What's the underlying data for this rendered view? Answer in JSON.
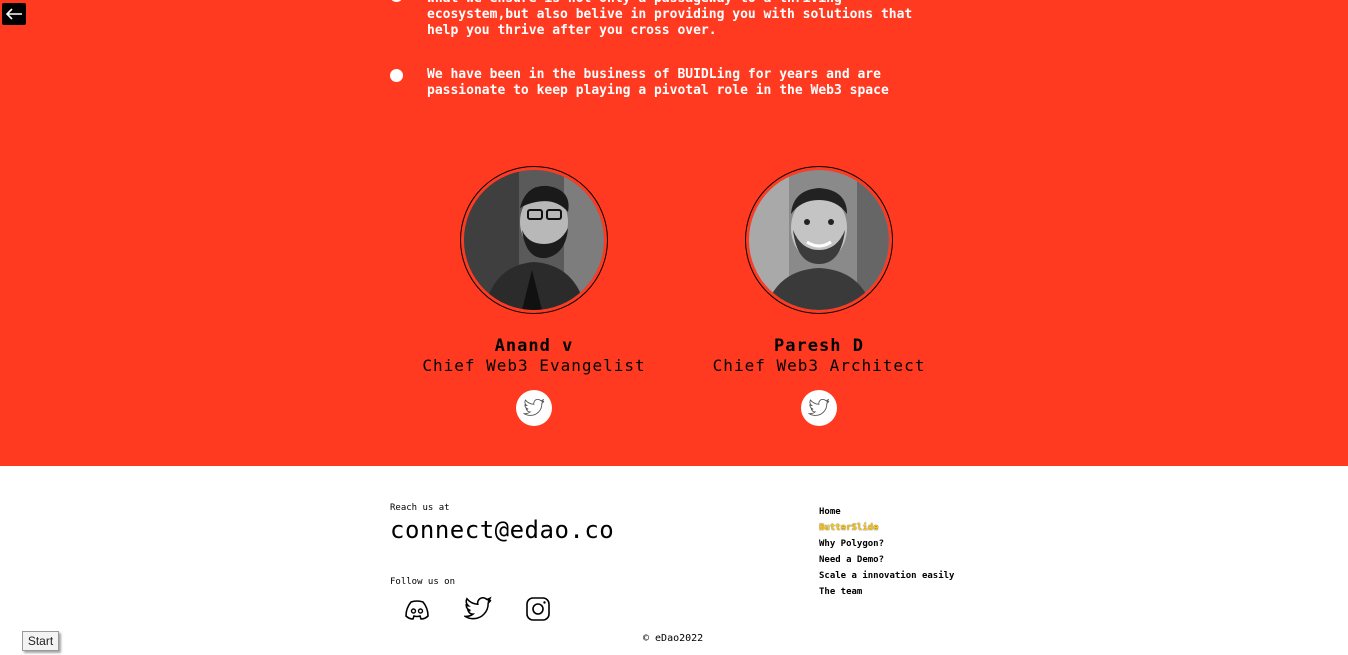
{
  "bullets": [
    {
      "text": "what we ensure is not only a passageway to a thriving\necosystem,but also belive in providing you with solutions that\nhelp you thrive after you cross over."
    },
    {
      "text": "We have been in the business of BUIDLing for years and are\npassionate to keep playing a pivotal role in the Web3 space"
    }
  ],
  "team": [
    {
      "name": "Anand v",
      "role": "Chief Web3 Evangelist"
    },
    {
      "name": "Paresh D",
      "role": "Chief Web3 Architect"
    }
  ],
  "footer": {
    "reach_label": "Reach us at",
    "email": "connect@edao.co",
    "follow_label": "Follow us on",
    "nav": [
      {
        "label": "Home",
        "active": false
      },
      {
        "label": "ButterSlide",
        "active": true
      },
      {
        "label": "Why Polygon?",
        "active": false
      },
      {
        "label": "Need a Demo?",
        "active": false
      },
      {
        "label": "Scale a innovation easily",
        "active": false
      },
      {
        "label": "The team",
        "active": false
      }
    ],
    "copyright": "© eDao2022"
  },
  "start_button": "Start",
  "colors": {
    "brand_red": "#ff3a20",
    "active_link": "#ffc90e"
  },
  "icons": [
    "back-arrow-icon",
    "twitter-icon",
    "discord-icon",
    "instagram-icon"
  ]
}
